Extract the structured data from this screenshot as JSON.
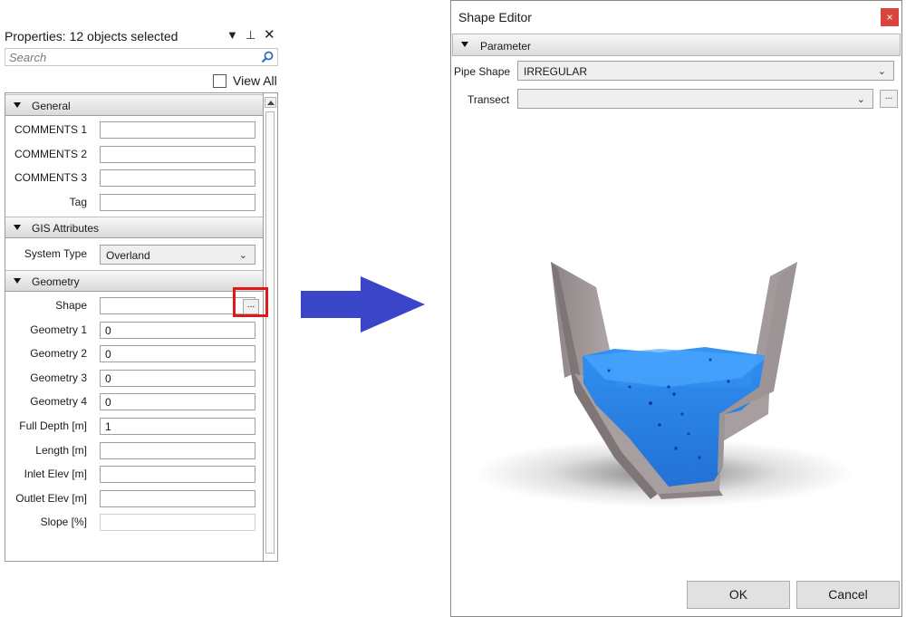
{
  "properties": {
    "title": "Properties: 12 objects selected",
    "search_placeholder": "Search",
    "view_all_label": "View All",
    "categories": [
      {
        "label": "General"
      },
      {
        "label": "GIS Attributes"
      },
      {
        "label": "Geometry"
      }
    ],
    "general": [
      {
        "label": "COMMENTS 1",
        "value": ""
      },
      {
        "label": "COMMENTS 2",
        "value": ""
      },
      {
        "label": "COMMENTS 3",
        "value": ""
      },
      {
        "label": "Tag",
        "value": ""
      }
    ],
    "gis": {
      "system_type_label": "System Type",
      "system_type_value": "Overland"
    },
    "geometry": [
      {
        "label": "Shape",
        "value": ""
      },
      {
        "label": "Geometry 1",
        "value": "0"
      },
      {
        "label": "Geometry 2",
        "value": "0"
      },
      {
        "label": "Geometry 3",
        "value": "0"
      },
      {
        "label": "Geometry 4",
        "value": "0"
      },
      {
        "label": "Full Depth [m]",
        "value": "1"
      },
      {
        "label": "Length [m]",
        "value": ""
      },
      {
        "label": "Inlet Elev [m]",
        "value": ""
      },
      {
        "label": "Outlet Elev [m]",
        "value": ""
      },
      {
        "label": "Slope [%]",
        "value": ""
      }
    ],
    "ellipsis": "..."
  },
  "shape_editor": {
    "title": "Shape Editor",
    "close": "×",
    "section": "Parameter",
    "pipe_shape_label": "Pipe Shape",
    "pipe_shape_value": "IRREGULAR",
    "transect_label": "Transect",
    "transect_value": "",
    "transect_button": "...",
    "ok_label": "OK",
    "cancel_label": "Cancel"
  },
  "colors": {
    "highlight": "#e01818",
    "arrow": "#3a45c8",
    "water": "#1f86f0",
    "channel_wall": "#9a8f90",
    "close_button": "#d9443f"
  }
}
